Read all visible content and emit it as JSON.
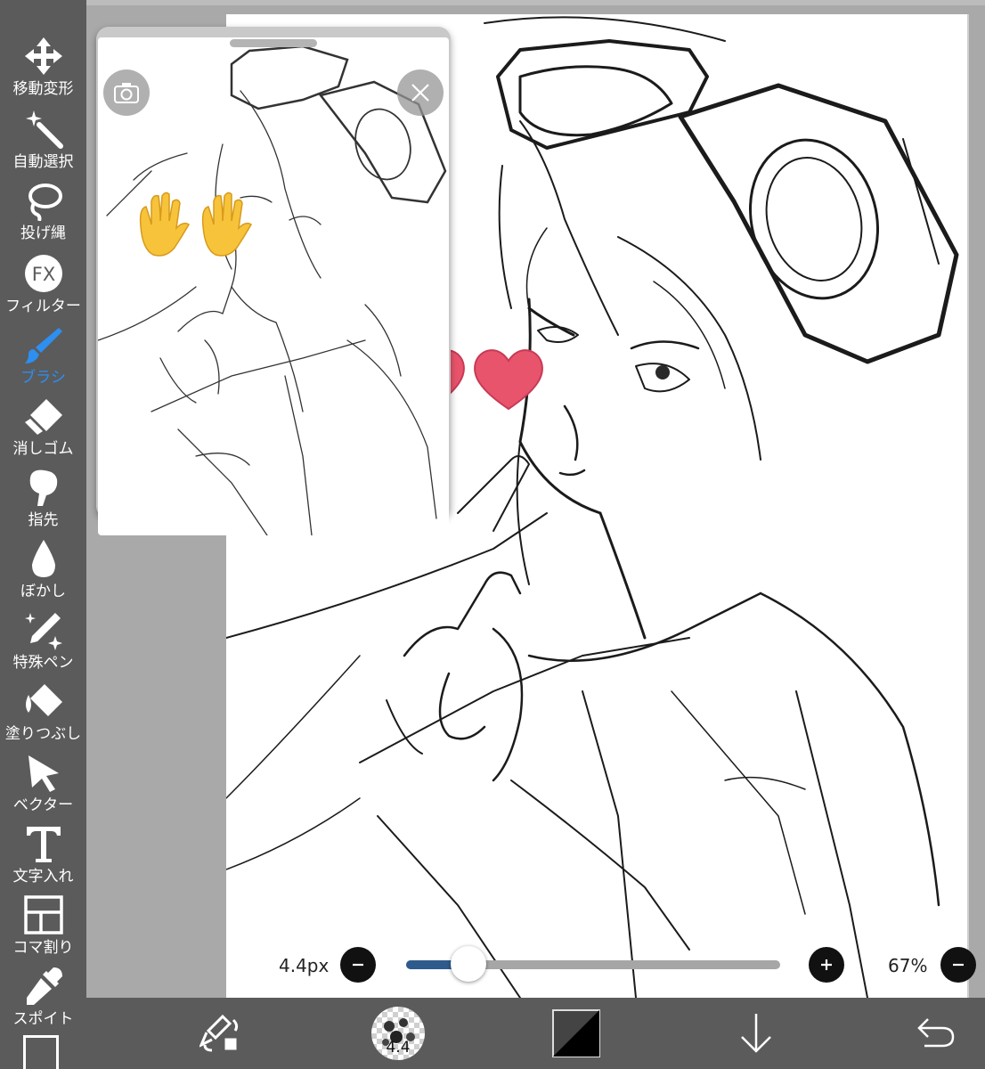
{
  "toolbar": {
    "items": [
      {
        "label": "移動変形",
        "icon": "move-transform-icon"
      },
      {
        "label": "自動選択",
        "icon": "magic-wand-icon"
      },
      {
        "label": "投げ縄",
        "icon": "lasso-icon"
      },
      {
        "label": "フィルター",
        "icon": "filter-fx-icon"
      },
      {
        "label": "ブラシ",
        "icon": "brush-icon",
        "active": true
      },
      {
        "label": "消しゴム",
        "icon": "eraser-icon"
      },
      {
        "label": "指先",
        "icon": "finger-smudge-icon"
      },
      {
        "label": "ぼかし",
        "icon": "blur-drop-icon"
      },
      {
        "label": "特殊ペン",
        "icon": "special-pen-icon"
      },
      {
        "label": "塗りつぶし",
        "icon": "bucket-fill-icon"
      },
      {
        "label": "ベクター",
        "icon": "vector-arrow-icon"
      },
      {
        "label": "文字入れ",
        "icon": "text-icon"
      },
      {
        "label": "コマ割り",
        "icon": "frame-divider-icon"
      },
      {
        "label": "スポイト",
        "icon": "eyedropper-icon"
      }
    ],
    "active_color": "#2d8ff0"
  },
  "brush_bar": {
    "size_label": "4.4px",
    "size_fraction": 0.12,
    "zoom_label": "67%"
  },
  "bottom_bar": {
    "brush_preview_value": "4.4",
    "icons": [
      "swap-tool-icon",
      "brush-preview-icon",
      "color-swatch-icon",
      "layer-down-arrow-icon",
      "undo-icon"
    ]
  },
  "reference_window": {
    "icons": [
      "camera-icon",
      "close-icon"
    ]
  },
  "stickers": [
    "raised-hands-emoji",
    "heart-emoji",
    "heart-emoji"
  ]
}
